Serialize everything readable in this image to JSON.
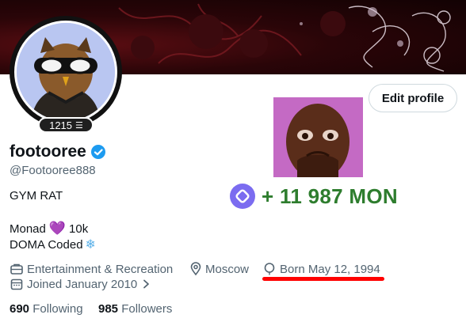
{
  "profile": {
    "display_name": "footooree",
    "handle": "@Footooree888",
    "level": "1215",
    "verified_icon": "verified-badge-icon",
    "edit_button": "Edit profile"
  },
  "bio": {
    "line1": "GYM RAT",
    "line2_prefix": "Monad",
    "line2_suffix": "10k",
    "line3": "DOMA Coded"
  },
  "overlay": {
    "mon_amount": "+ 11 987 MON",
    "mon_color": "#2e7d2e",
    "highlight_color": "#ff0000"
  },
  "meta": {
    "category": "Entertainment & Recreation",
    "location": "Moscow",
    "born": "Born May 12, 1994",
    "joined": "Joined January 2010"
  },
  "stats": {
    "following_count": "690",
    "following_label": "Following",
    "followers_count": "985",
    "followers_label": "Followers"
  },
  "colors": {
    "accent": "#1d9bf0",
    "muted_text": "#536471"
  }
}
